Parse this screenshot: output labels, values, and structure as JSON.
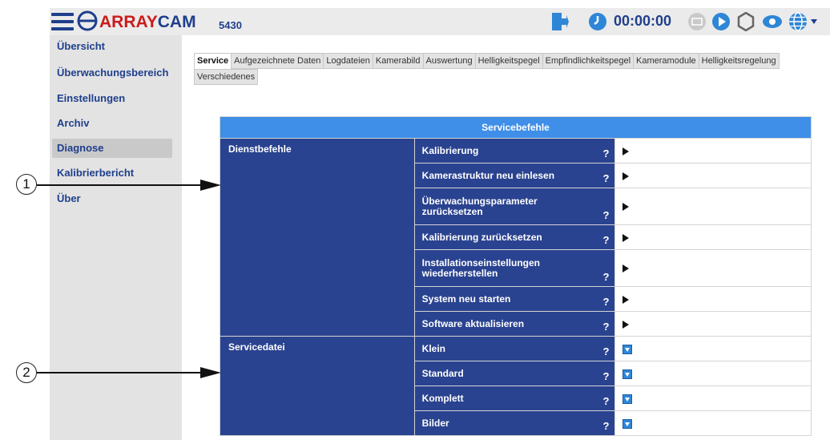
{
  "header": {
    "brand_red": "ARRAY",
    "brand_blue": "CAM",
    "model": "5430",
    "clock": "00:00:00"
  },
  "icons": [
    "menu-icon",
    "logo-mark-icon",
    "logout-icon",
    "clock-icon",
    "keyboard-icon",
    "play-icon",
    "settings-icon",
    "eye-icon",
    "globe-icon"
  ],
  "sidebar": {
    "items": [
      {
        "label": "Übersicht"
      },
      {
        "label": "Überwachungsbereich"
      },
      {
        "label": "Einstellungen"
      },
      {
        "label": "Archiv"
      },
      {
        "label": "Diagnose",
        "active": true
      },
      {
        "label": "Kalibrierbericht"
      },
      {
        "label": "Über"
      }
    ]
  },
  "tabs": [
    {
      "label": "Service",
      "active": true
    },
    {
      "label": "Aufgezeichnete Daten"
    },
    {
      "label": "Logdateien"
    },
    {
      "label": "Kamerabild"
    },
    {
      "label": "Auswertung"
    },
    {
      "label": "Helligkeitspegel"
    },
    {
      "label": "Empfindlichkeitspegel"
    },
    {
      "label": "Kameramodule"
    },
    {
      "label": "Helligkeitsregelung"
    },
    {
      "label": "Verschiedenes"
    }
  ],
  "table": {
    "title": "Servicebefehle",
    "help_symbol": "?",
    "groups": [
      {
        "name": "Dienstbefehle",
        "rows": [
          {
            "label": "Kalibrierung",
            "action": "run"
          },
          {
            "label": "Kamerastruktur neu einlesen",
            "action": "run"
          },
          {
            "label": "Überwachungsparameter zurücksetzen",
            "action": "run"
          },
          {
            "label": "Kalibrierung zurücksetzen",
            "action": "run"
          },
          {
            "label": "Installationseinstellungen wiederherstellen",
            "action": "run"
          },
          {
            "label": "System neu starten",
            "action": "run"
          },
          {
            "label": "Software aktualisieren",
            "action": "run"
          }
        ]
      },
      {
        "name": "Servicedatei",
        "rows": [
          {
            "label": "Klein",
            "action": "download"
          },
          {
            "label": "Standard",
            "action": "download"
          },
          {
            "label": "Komplett",
            "action": "download"
          },
          {
            "label": "Bilder",
            "action": "download"
          }
        ]
      }
    ]
  },
  "callouts": [
    "1",
    "2"
  ],
  "colors": {
    "navy": "#2a4390",
    "header_blue": "#3f8ee8",
    "brand_red": "#cc1b1b",
    "text_blue": "#1f3f8c"
  }
}
